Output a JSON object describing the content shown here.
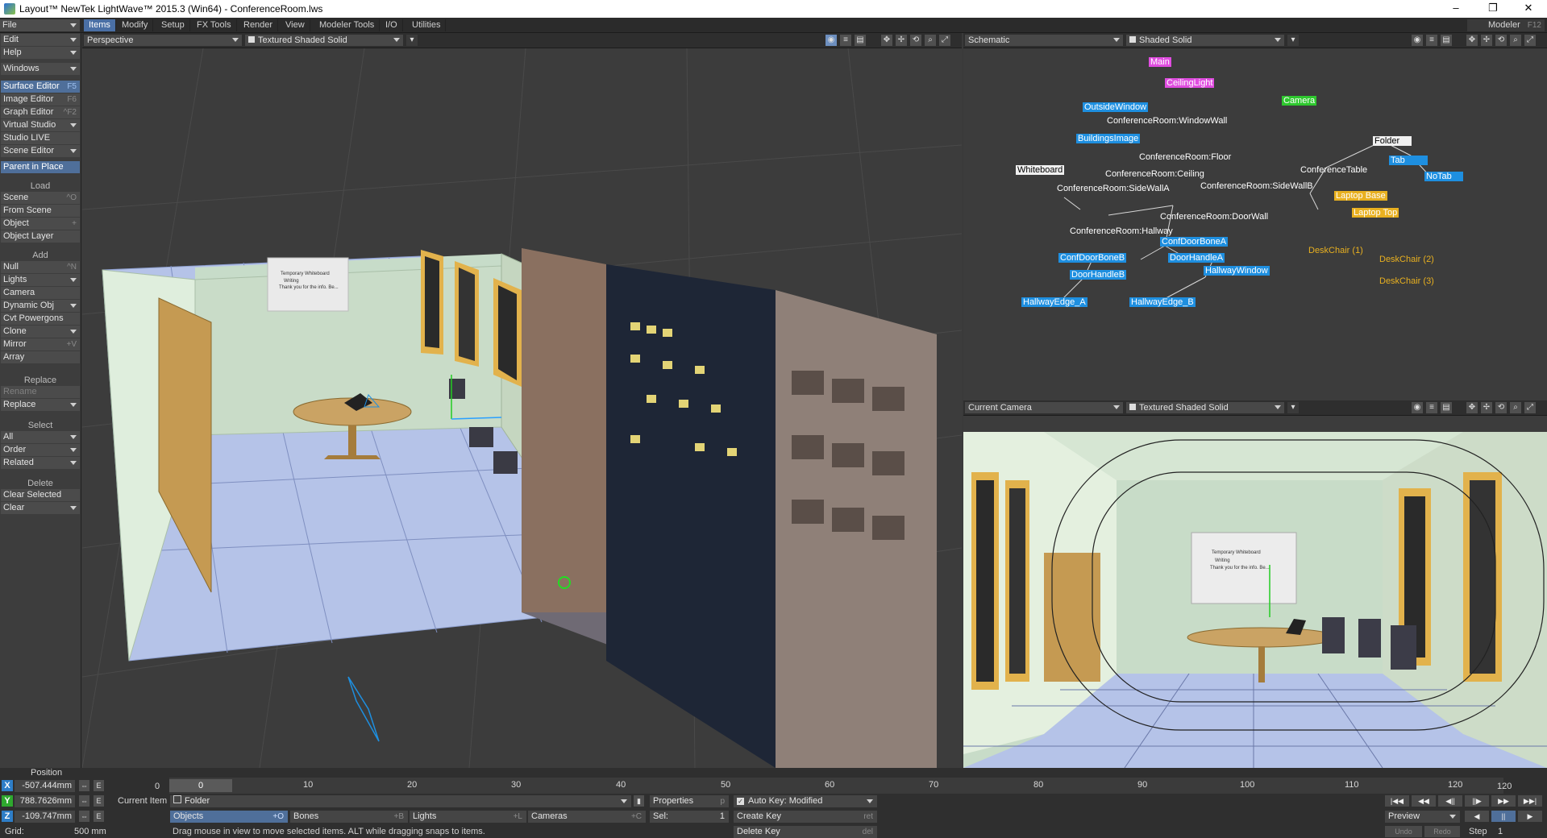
{
  "window": {
    "title": "Layout™ NewTek LightWave™ 2015.3 (Win64) - ConferenceRoom.lws",
    "minimize": "–",
    "restore": "❐",
    "close": "✕"
  },
  "menus": [
    {
      "label": "File"
    },
    {
      "label": "Edit"
    },
    {
      "label": "Help"
    },
    {
      "label": "Windows"
    }
  ],
  "tabs": [
    "Items",
    "Modify",
    "Setup",
    "FX Tools",
    "Render",
    "View",
    "Modeler Tools",
    "I/O",
    "Utilities"
  ],
  "modeler": {
    "label": "Modeler",
    "shortcut": "F12"
  },
  "toolbar": {
    "editors": [
      {
        "label": "Surface Editor",
        "shortcut": "F5",
        "highlight": true
      },
      {
        "label": "Image Editor",
        "shortcut": "F6"
      },
      {
        "label": "Graph Editor",
        "shortcut": "^F2"
      },
      {
        "label": "Virtual Studio",
        "dropdown": true
      },
      {
        "label": "Studio LIVE"
      },
      {
        "label": "Scene Editor",
        "dropdown": true
      }
    ],
    "parent_in_place": "Parent in Place",
    "load_header": "Load",
    "load": [
      {
        "label": "Scene",
        "shortcut": "^O"
      },
      {
        "label": "From Scene"
      },
      {
        "label": "Object",
        "shortcut": "+"
      },
      {
        "label": "Object Layer"
      }
    ],
    "add_header": "Add",
    "add": [
      {
        "label": "Null",
        "shortcut": "^N"
      },
      {
        "label": "Lights",
        "dropdown": true
      },
      {
        "label": "Camera"
      },
      {
        "label": "Dynamic Obj",
        "dropdown": true
      },
      {
        "label": "Cvt Powergons"
      },
      {
        "label": "Clone",
        "dropdown": true
      },
      {
        "label": "Mirror",
        "shortcut": "+V"
      },
      {
        "label": "Array"
      }
    ],
    "replace_header": "Replace",
    "replace": [
      {
        "label": "Rename",
        "disabled": true
      },
      {
        "label": "Replace",
        "dropdown": true
      }
    ],
    "select_header": "Select",
    "select": [
      {
        "label": "All",
        "dropdown": true
      },
      {
        "label": "Order",
        "dropdown": true
      },
      {
        "label": "Related",
        "dropdown": true
      }
    ],
    "delete_header": "Delete",
    "delete": [
      {
        "label": "Clear Selected"
      },
      {
        "label": "Clear",
        "dropdown": true
      }
    ]
  },
  "viewports": {
    "main": {
      "view": "Perspective",
      "mode": "Textured Shaded Solid"
    },
    "schematic": {
      "view": "Schematic",
      "mode": "Shaded Solid"
    },
    "camera": {
      "view": "Current Camera",
      "mode": "Textured Shaded Solid"
    }
  },
  "whiteboard_text": {
    "line1": "Temporary Whiteboard",
    "line2": "Writing",
    "line3": "Thank you for the info. Be..."
  },
  "schematic_nodes": [
    {
      "label": "Main",
      "color": "#e04de0"
    },
    {
      "label": "CeilingLight",
      "color": "#e04de0"
    },
    {
      "label": "Camera",
      "color": "#2ec82e"
    },
    {
      "label": "OutsideWindow",
      "color": "#1e8fe0"
    },
    {
      "label": "ConferenceRoom:WindowWall",
      "color": "#e04de0"
    },
    {
      "label": "BuildingsImage",
      "color": "#1e8fe0"
    },
    {
      "label": "Folder",
      "color": "#e8e8e8"
    },
    {
      "label": "Tab",
      "color": "#1e8fe0"
    },
    {
      "label": "NoTab",
      "color": "#1e8fe0"
    },
    {
      "label": "ConferenceRoom:Floor",
      "color": "#e04de0"
    },
    {
      "label": "ConferenceRoom:Ceiling",
      "color": "#e04de0"
    },
    {
      "label": "ConferenceTable",
      "color": "#e8e8e8"
    },
    {
      "label": "Whiteboard",
      "color": "#e8e8e8"
    },
    {
      "label": "ConferenceRoom:SideWallA",
      "color": "#e04de0"
    },
    {
      "label": "ConferenceRoom:SideWallB",
      "color": "#e04de0"
    },
    {
      "label": "Laptop Base",
      "color": "#e8b020"
    },
    {
      "label": "Laptop Top",
      "color": "#e8b020"
    },
    {
      "label": "ConferenceRoom:DoorWall",
      "color": "#e04de0"
    },
    {
      "label": "ConferenceRoom:Hallway",
      "color": "#e04de0"
    },
    {
      "label": "ConfDoorBoneA",
      "color": "#1e8fe0"
    },
    {
      "label": "ConfDoorBoneB",
      "color": "#1e8fe0"
    },
    {
      "label": "DoorHandleA",
      "color": "#1e8fe0"
    },
    {
      "label": "HallwayWindow",
      "color": "#1e8fe0"
    },
    {
      "label": "DoorHandleB",
      "color": "#1e8fe0"
    },
    {
      "label": "DeskChair (1)",
      "color": "#e8b020"
    },
    {
      "label": "DeskChair (2)",
      "color": "#e8b020"
    },
    {
      "label": "DeskChair (3)",
      "color": "#e8b020"
    },
    {
      "label": "HallwayEdge_A",
      "color": "#1e8fe0"
    },
    {
      "label": "HallwayEdge_B",
      "color": "#1e8fe0"
    }
  ],
  "position": {
    "label": "Position",
    "x": "-507.444mm",
    "y": "788.7626mm",
    "z": "-109.747mm",
    "grid_label": "Grid:",
    "grid_value": "500 mm"
  },
  "timeline": {
    "start": "0",
    "current": "0",
    "ticks": [
      "0",
      "10",
      "20",
      "30",
      "40",
      "50",
      "60",
      "70",
      "80",
      "90",
      "100",
      "110",
      "120"
    ],
    "end": "120"
  },
  "current_item": {
    "label": "Current Item",
    "value": "Folder",
    "properties": "Properties",
    "properties_shortcut": "p"
  },
  "item_types": [
    {
      "label": "Objects",
      "shortcut": "+O",
      "active": true
    },
    {
      "label": "Bones",
      "shortcut": "+B"
    },
    {
      "label": "Lights",
      "shortcut": "+L"
    },
    {
      "label": "Cameras",
      "shortcut": "+C"
    }
  ],
  "sel": {
    "label": "Sel:",
    "value": "1"
  },
  "keys": {
    "auto_key": "Auto Key: Modified",
    "create_key": "Create Key",
    "create_key_shortcut": "ret",
    "delete_key": "Delete Key",
    "delete_key_shortcut": "del"
  },
  "status": "Drag mouse in view to move selected items. ALT while dragging snaps to items.",
  "playback": {
    "preview": "Preview",
    "undo": "Undo",
    "redo": "Redo",
    "step_label": "Step",
    "step_value": "1"
  }
}
